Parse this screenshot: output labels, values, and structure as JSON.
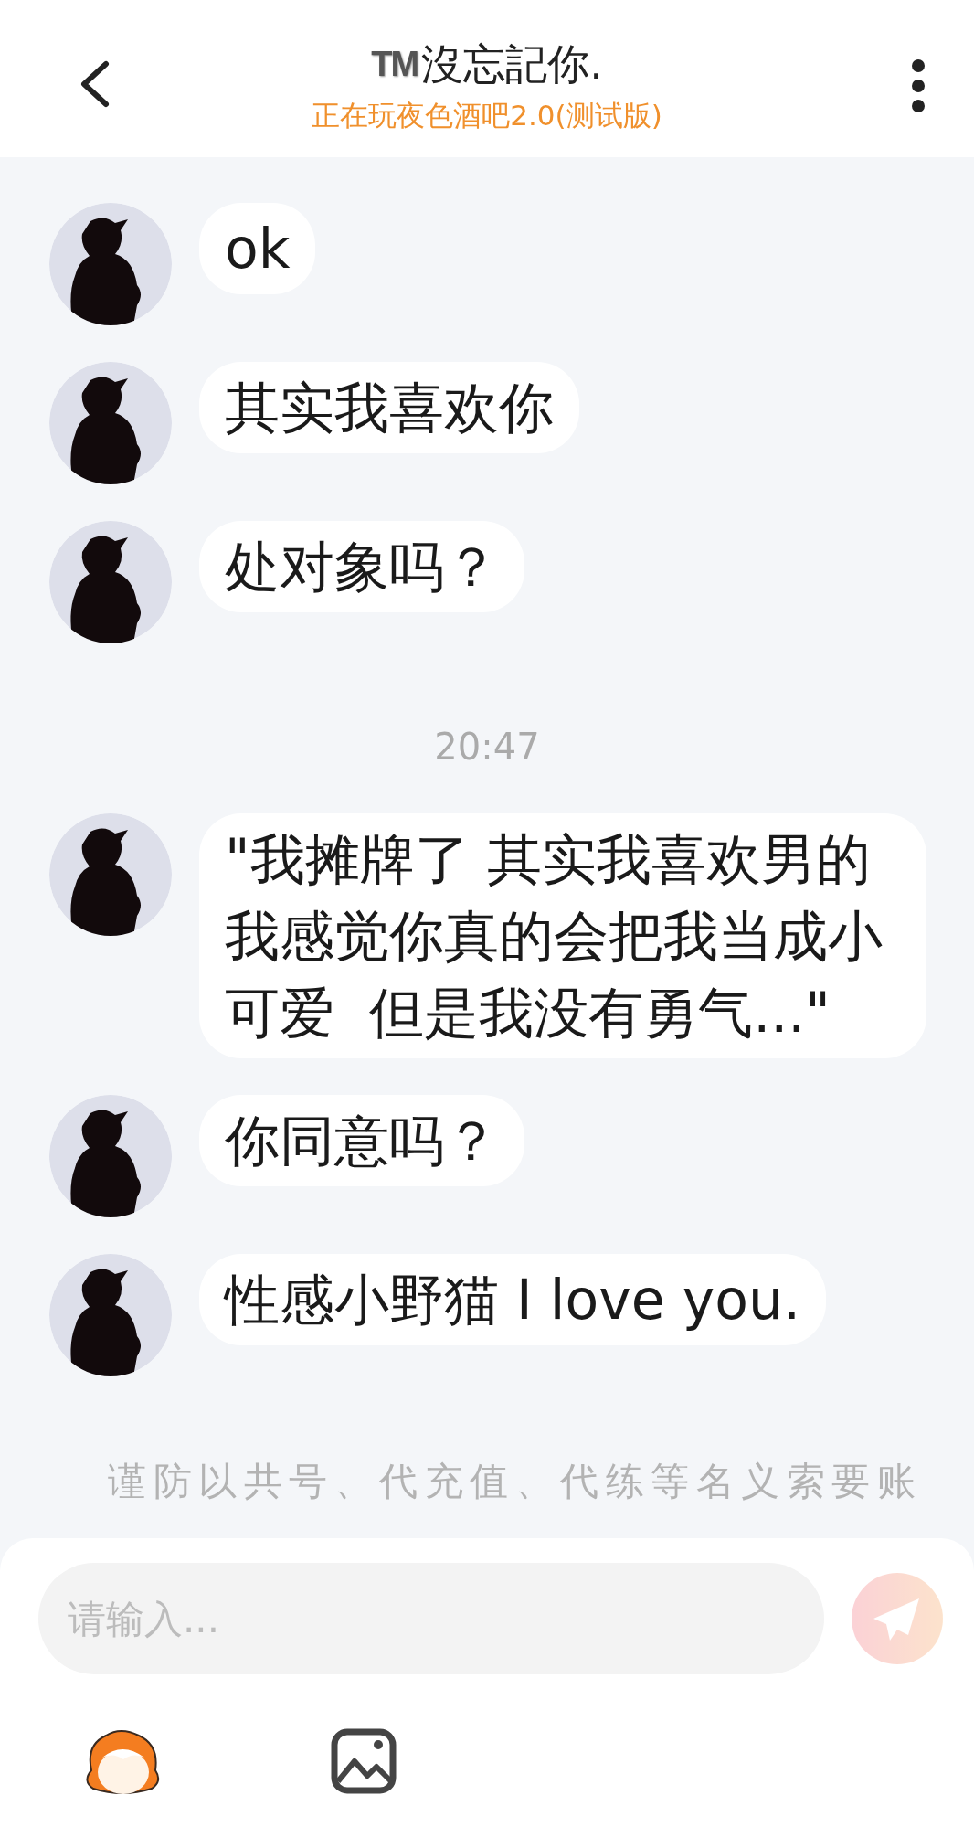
{
  "header": {
    "badge": "TM",
    "title": "沒忘記你.",
    "subtitle": "正在玩夜色酒吧2.0(测试版)"
  },
  "messages": [
    {
      "kind": "message",
      "text": "ok"
    },
    {
      "kind": "message",
      "text": "其实我喜欢你"
    },
    {
      "kind": "message",
      "text": "处对象吗？"
    },
    {
      "kind": "time",
      "text": "20:47"
    },
    {
      "kind": "message",
      "text": "\"我摊牌了 其实我喜欢男的我感觉你真的会把我当成小可爱  但是我没有勇气...\""
    },
    {
      "kind": "message",
      "text": "你同意吗？"
    },
    {
      "kind": "message",
      "text": "性感小野猫 I love you."
    }
  ],
  "notice": "谨防以共号、代充值、代练等名义索要账",
  "composer": {
    "placeholder": "请输入...",
    "send_disabled": true
  }
}
